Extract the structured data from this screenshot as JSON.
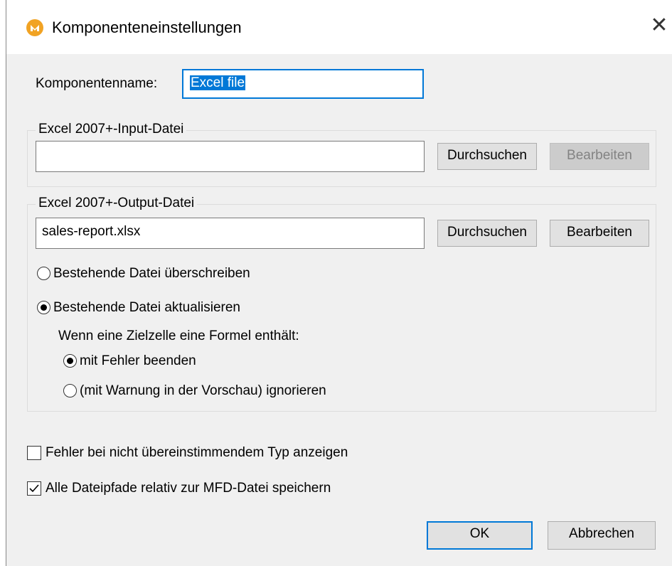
{
  "window": {
    "title": "Komponenteneinstellungen"
  },
  "component_name": {
    "label": "Komponentenname:",
    "value": "Excel file"
  },
  "input_file": {
    "group_title": "Excel 2007+-Input-Datei",
    "path": "",
    "browse_label": "Durchsuchen",
    "edit_label": "Bearbeiten"
  },
  "output_file": {
    "group_title": "Excel 2007+-Output-Datei",
    "path": "sales-report.xlsx",
    "browse_label": "Durchsuchen",
    "edit_label": "Bearbeiten",
    "overwrite_label": "Bestehende Datei überschreiben",
    "update_label": "Bestehende Datei aktualisieren",
    "selected": "update",
    "formula_prompt": "Wenn eine Zielzelle eine Formel enthält:",
    "abort_label": "mit Fehler beenden",
    "ignore_label": "(mit Warnung in der Vorschau) ignorieren",
    "formula_selected": "abort"
  },
  "options": {
    "type_mismatch_label": "Fehler bei nicht übereinstimmendem Typ anzeigen",
    "type_mismatch_checked": false,
    "relative_paths_label": "Alle Dateipfade relativ zur MFD-Datei speichern",
    "relative_paths_checked": true
  },
  "footer": {
    "ok_label": "OK",
    "cancel_label": "Abbrechen"
  },
  "colors": {
    "accent": "#0078d7",
    "app_icon": "#f1a324"
  }
}
